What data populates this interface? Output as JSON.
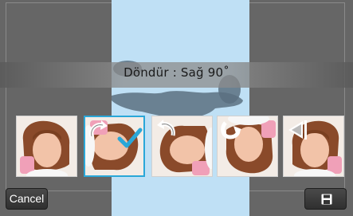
{
  "rotation": {
    "label": "Döndür : Sağ 90˚"
  },
  "thumbnails": [
    {
      "name": "original"
    },
    {
      "name": "rotate-right-90",
      "selected": true
    },
    {
      "name": "rotate-left-90"
    },
    {
      "name": "rotate-180"
    },
    {
      "name": "flip-horizontal"
    }
  ],
  "footer": {
    "cancel_label": "Cancel",
    "save_icon": "floppy-disk-icon"
  },
  "colors": {
    "accent": "#2aa7d8",
    "preview_bg": "#bfe0f5",
    "screen_bg": "#666666"
  }
}
